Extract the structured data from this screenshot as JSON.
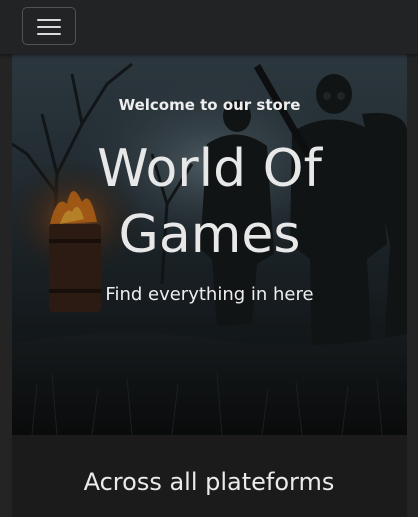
{
  "navbar": {
    "menu_icon": "hamburger-menu-icon"
  },
  "hero": {
    "tagline": "Welcome to our store",
    "title_line1": "World Of",
    "title_line2": "Games",
    "subtitle": "Find everything in here"
  },
  "section": {
    "title": "Across all plateforms"
  },
  "colors": {
    "page_bg": "#1b1b1b",
    "navbar_bg": "#222325",
    "text": "#eeeeee"
  }
}
